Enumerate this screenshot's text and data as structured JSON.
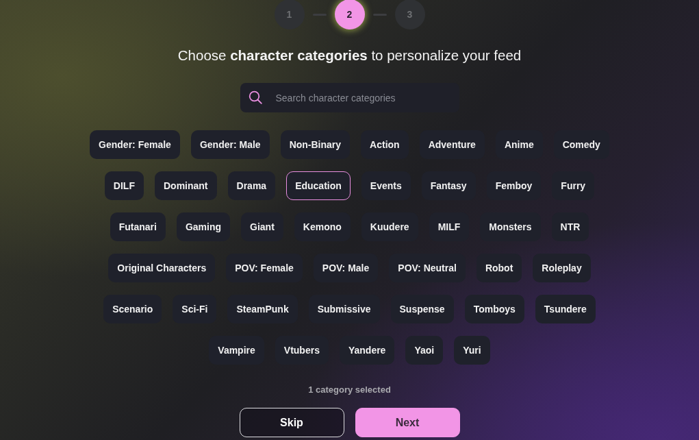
{
  "steps": [
    {
      "label": "1",
      "selected": false
    },
    {
      "label": "2",
      "selected": true
    },
    {
      "label": "3",
      "selected": false
    }
  ],
  "heading": "Choose **character categories** to personalize your feed",
  "search": {
    "placeholder": "Search character categories"
  },
  "category_rows": [
    {
      "chips": [
        {
          "label": "Gender: Female",
          "selected": false
        },
        {
          "label": "Gender: Male",
          "selected": false
        },
        {
          "label": "Non-Binary",
          "selected": false
        },
        {
          "label": "Action",
          "selected": false
        },
        {
          "label": "Adventure",
          "selected": false
        },
        {
          "label": "Anime",
          "selected": false
        },
        {
          "label": "Comedy",
          "selected": false
        }
      ]
    },
    {
      "chips": [
        {
          "label": "DILF",
          "selected": false
        },
        {
          "label": "Dominant",
          "selected": false
        },
        {
          "label": "Drama",
          "selected": false
        },
        {
          "label": "Education",
          "selected": true
        },
        {
          "label": "Events",
          "selected": false
        },
        {
          "label": "Fantasy",
          "selected": false
        },
        {
          "label": "Femboy",
          "selected": false
        },
        {
          "label": "Furry",
          "selected": false
        }
      ]
    },
    {
      "chips": [
        {
          "label": "Futanari",
          "selected": false
        },
        {
          "label": "Gaming",
          "selected": false
        },
        {
          "label": "Giant",
          "selected": false
        },
        {
          "label": "Kemono",
          "selected": false
        },
        {
          "label": "Kuudere",
          "selected": false
        },
        {
          "label": "MILF",
          "selected": false
        },
        {
          "label": "Monsters",
          "selected": false
        },
        {
          "label": "NTR",
          "selected": false
        }
      ]
    },
    {
      "chips": [
        {
          "label": "Original Characters",
          "selected": false
        },
        {
          "label": "POV: Female",
          "selected": false
        },
        {
          "label": "POV: Male",
          "selected": false
        },
        {
          "label": "POV: Neutral",
          "selected": false
        },
        {
          "label": "Robot",
          "selected": false
        },
        {
          "label": "Roleplay",
          "selected": false
        }
      ]
    },
    {
      "chips": [
        {
          "label": "Scenario",
          "selected": false
        },
        {
          "label": "Sci-Fi",
          "selected": false
        },
        {
          "label": "SteamPunk",
          "selected": false
        },
        {
          "label": "Submissive",
          "selected": false
        },
        {
          "label": "Suspense",
          "selected": false
        },
        {
          "label": "Tomboys",
          "selected": false
        },
        {
          "label": "Tsundere",
          "selected": false
        }
      ]
    },
    {
      "chips": [
        {
          "label": "Vampire",
          "selected": false
        },
        {
          "label": "Vtubers",
          "selected": false
        },
        {
          "label": "Yandere",
          "selected": false
        },
        {
          "label": "Yaoi",
          "selected": false
        },
        {
          "label": "Yuri",
          "selected": false
        }
      ]
    }
  ],
  "selection_count": "1 category selected",
  "buttons": [
    {
      "label": "Skip",
      "kind": "secondary"
    },
    {
      "label": "Next",
      "kind": "primary"
    }
  ]
}
